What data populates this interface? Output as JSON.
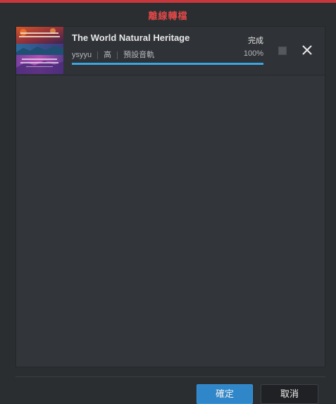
{
  "dialog": {
    "title": "離線轉檔"
  },
  "task": {
    "title": "The World Natural Heritage",
    "user": "ysyyu",
    "quality": "高",
    "audio_track": "預設音軌",
    "status": "完成",
    "progress_text": "100%",
    "progress": 1.0,
    "thumbnail_icon": "video-thumbnail"
  },
  "buttons": {
    "confirm_label": "確定",
    "cancel_label": "取消"
  },
  "colors": {
    "accent": "#c8373c",
    "title": "#e04848",
    "progress": "#3ba6e0",
    "primary_button": "#2f86c9"
  }
}
